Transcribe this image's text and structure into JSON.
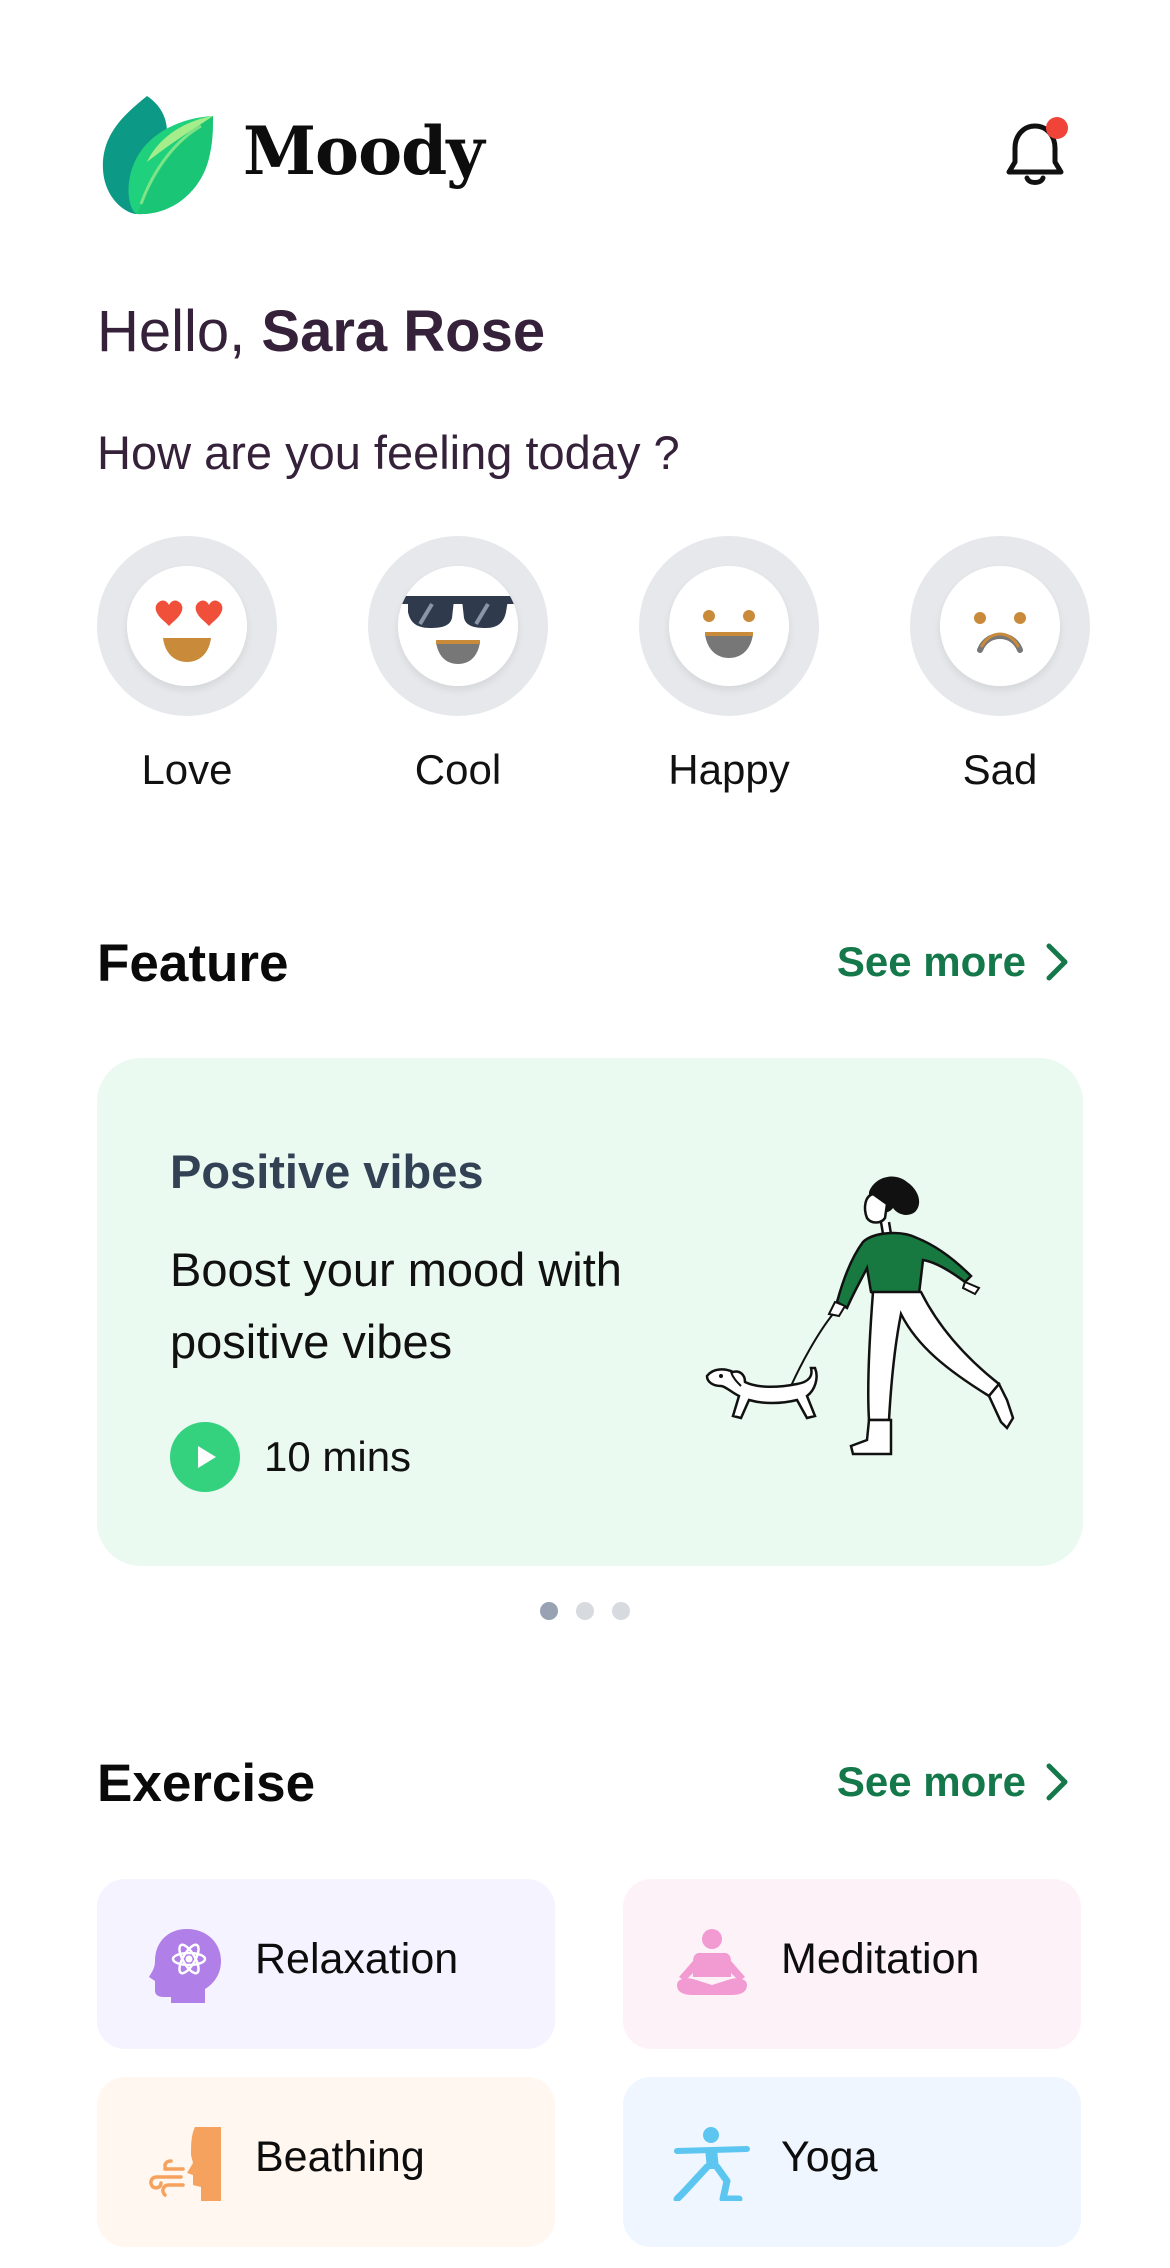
{
  "app": {
    "name": "Moody"
  },
  "header": {
    "icons": [
      "leaf-logo-icon",
      "bell-icon"
    ],
    "has_notification": true
  },
  "greeting": {
    "prefix": "Hello, ",
    "name": "Sara Rose"
  },
  "mood_prompt": "How are you feeling today ?",
  "moods": [
    {
      "label": "Love",
      "icon": "love-face-icon"
    },
    {
      "label": "Cool",
      "icon": "cool-face-icon"
    },
    {
      "label": "Happy",
      "icon": "happy-face-icon"
    },
    {
      "label": "Sad",
      "icon": "sad-face-icon"
    }
  ],
  "feature": {
    "title": "Feature",
    "see_more": "See more",
    "card": {
      "eyebrow": "Positive vibes",
      "description": "Boost your mood with positive vibes",
      "duration": "10 mins"
    },
    "pagination": {
      "total": 3,
      "active": 1
    }
  },
  "exercise": {
    "title": "Exercise",
    "see_more": "See more",
    "items": [
      {
        "label": "Relaxation",
        "icon": "relaxation-head-icon",
        "bg": "#f5f3ff",
        "color": "#b07fe8"
      },
      {
        "label": "Meditation",
        "icon": "meditation-icon",
        "bg": "#fdf2f8",
        "color": "#f29ad2"
      },
      {
        "label": "Beathing",
        "icon": "breathing-icon",
        "bg": "#fff7f0",
        "color": "#f5a25e"
      },
      {
        "label": "Yoga",
        "icon": "yoga-icon",
        "bg": "#eff6ff",
        "color": "#5cc6f0"
      }
    ]
  },
  "colors": {
    "accent_green": "#14784a",
    "play_green": "#34d27f",
    "card_bg": "#eafaf1",
    "notification_dot": "#f04438"
  }
}
